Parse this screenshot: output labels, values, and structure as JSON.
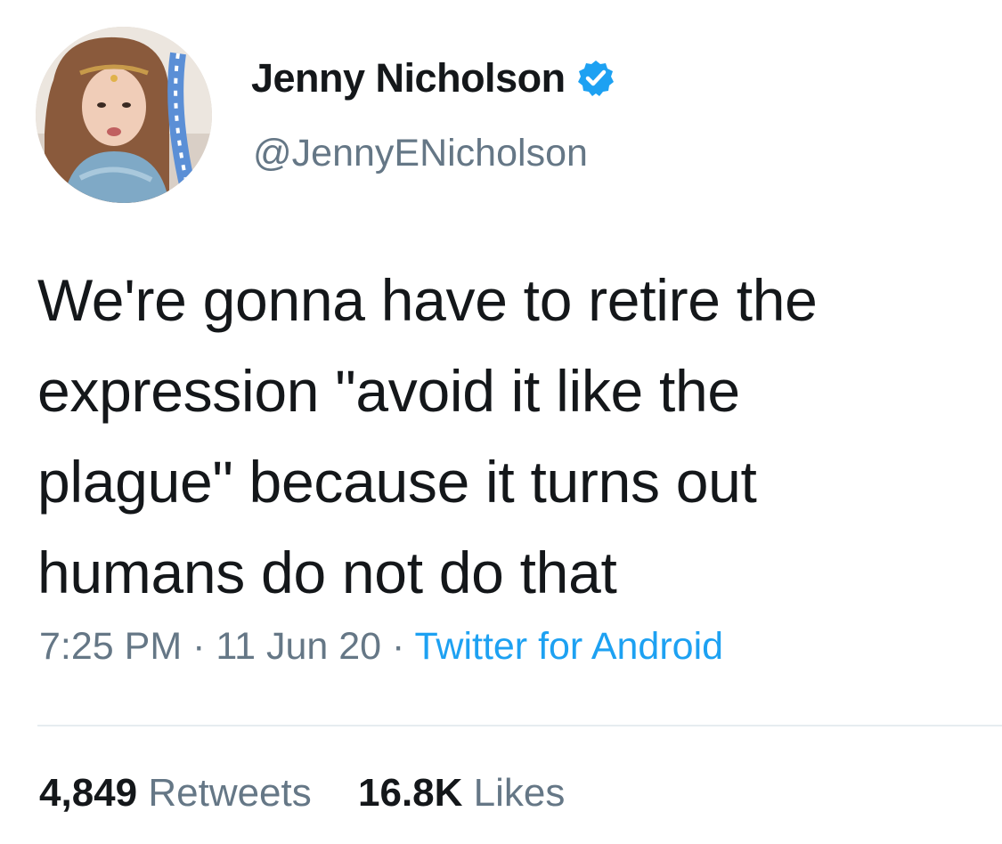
{
  "author": {
    "display_name": "Jenny Nicholson",
    "handle": "@JennyENicholson",
    "verified": true,
    "verified_icon": "verified-badge-icon"
  },
  "tweet": {
    "text_lines": [
      "We're gonna have to retire the",
      "expression \"avoid it like the",
      "plague\" because it turns out",
      "humans do not do that"
    ]
  },
  "meta": {
    "time": "7:25 PM",
    "separator": " · ",
    "date": "11 Jun 20",
    "source": "Twitter for Android"
  },
  "stats": {
    "retweets_count": "4,849",
    "retweets_label": "Retweets",
    "likes_count": "16.8K",
    "likes_label": "Likes"
  },
  "colors": {
    "primary_text": "#14171a",
    "secondary_text": "#657786",
    "link": "#1da1f2",
    "divider": "#e6ecf0"
  }
}
